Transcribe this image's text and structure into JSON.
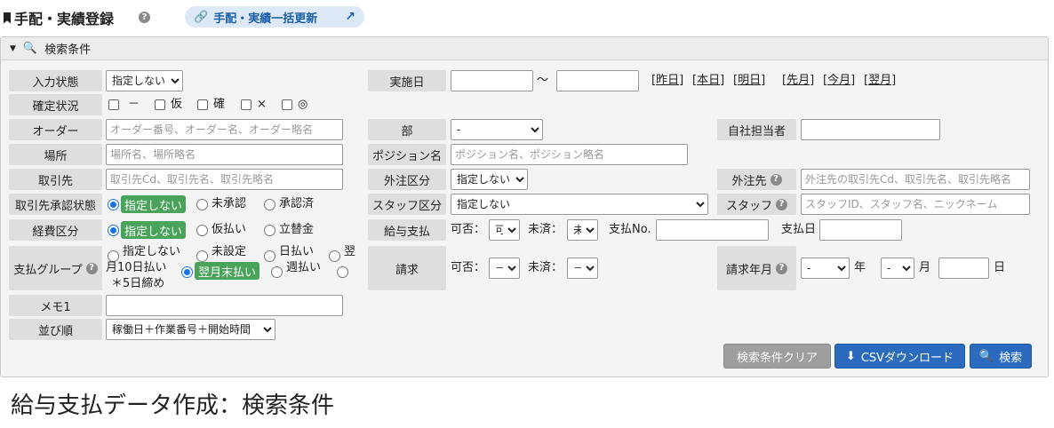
{
  "header": {
    "title": "手配・実績登録",
    "bulk_update_label": "手配・実績一括更新"
  },
  "panel": {
    "title": "検索条件"
  },
  "form": {
    "input_status": {
      "label": "入力状態",
      "value": "指定しない"
    },
    "confirm_status": {
      "label": "確定状況",
      "options": [
        "－",
        "仮",
        "確",
        "×",
        "◎"
      ]
    },
    "order": {
      "label": "オーダー",
      "placeholder": "オーダー番号、オーダー名、オーダー略名"
    },
    "place": {
      "label": "場所",
      "placeholder": "場所名、場所略名"
    },
    "client": {
      "label": "取引先",
      "placeholder": "取引先Cd、取引先名、取引先略名"
    },
    "client_approval": {
      "label": "取引先承認状態",
      "options": [
        "指定しない",
        "未承認",
        "承認済"
      ],
      "selected": "指定しない"
    },
    "expense_type": {
      "label": "経費区分",
      "options": [
        "指定しない",
        "仮払い",
        "立替金"
      ],
      "selected": "指定しない"
    },
    "payment_group": {
      "label": "支払グループ",
      "opt1": "指定しない",
      "opt2": "未設定",
      "opt3": "日払い",
      "opt4a": "翌",
      "opt4b": "月10日払い",
      "opt5": "翌月末払い",
      "opt6": "週払い",
      "opt7": "＊5日締め",
      "selected": "翌月末払い"
    },
    "memo1": {
      "label": "メモ1",
      "value": ""
    },
    "sort": {
      "label": "並び順",
      "value": "稼働日＋作業番号＋開始時間"
    },
    "date": {
      "label": "実施日",
      "tilde": "～",
      "links": [
        "[昨日]",
        "[本日]",
        "[明日]",
        "[先月]",
        "[今月]",
        "[翌月]"
      ]
    },
    "dept": {
      "label": "部",
      "value": "-"
    },
    "position": {
      "label": "ポジション名",
      "placeholder": "ポジション名、ポジション略名"
    },
    "outsource_type": {
      "label": "外注区分",
      "value": "指定しない"
    },
    "staff_type": {
      "label": "スタッフ区分",
      "value": "指定しない"
    },
    "salary_payment": {
      "label": "給与支払",
      "possible_label": "可否：",
      "possible_value": "可",
      "done_label": "未済：",
      "done_value": "未",
      "payno_label": "支払No.",
      "paydate_label": "支払日"
    },
    "billing": {
      "label": "請求",
      "possible_label": "可否：",
      "possible_value": "－",
      "done_label": "未済：",
      "done_value": "－"
    },
    "own_staff": {
      "label": "自社担当者"
    },
    "outsourcer": {
      "label": "外注先",
      "placeholder": "外注先の取引先Cd、取引先名、取引先略名"
    },
    "staff": {
      "label": "スタッフ",
      "placeholder": "スタッフID、スタッフ名、ニックネーム"
    },
    "billing_month": {
      "label": "請求年月",
      "year_value": "-",
      "year_label": "年",
      "month_value": "-",
      "month_label": "月",
      "day_label": "日"
    }
  },
  "buttons": {
    "clear": "検索条件クリア",
    "csv": "CSVダウンロード",
    "search": "検索"
  },
  "caption": "給与支払データ作成：検索条件",
  "colors": {
    "accent": "#2a6bbf",
    "green": "#4aa35b",
    "pill_bg": "#dde9f7"
  }
}
